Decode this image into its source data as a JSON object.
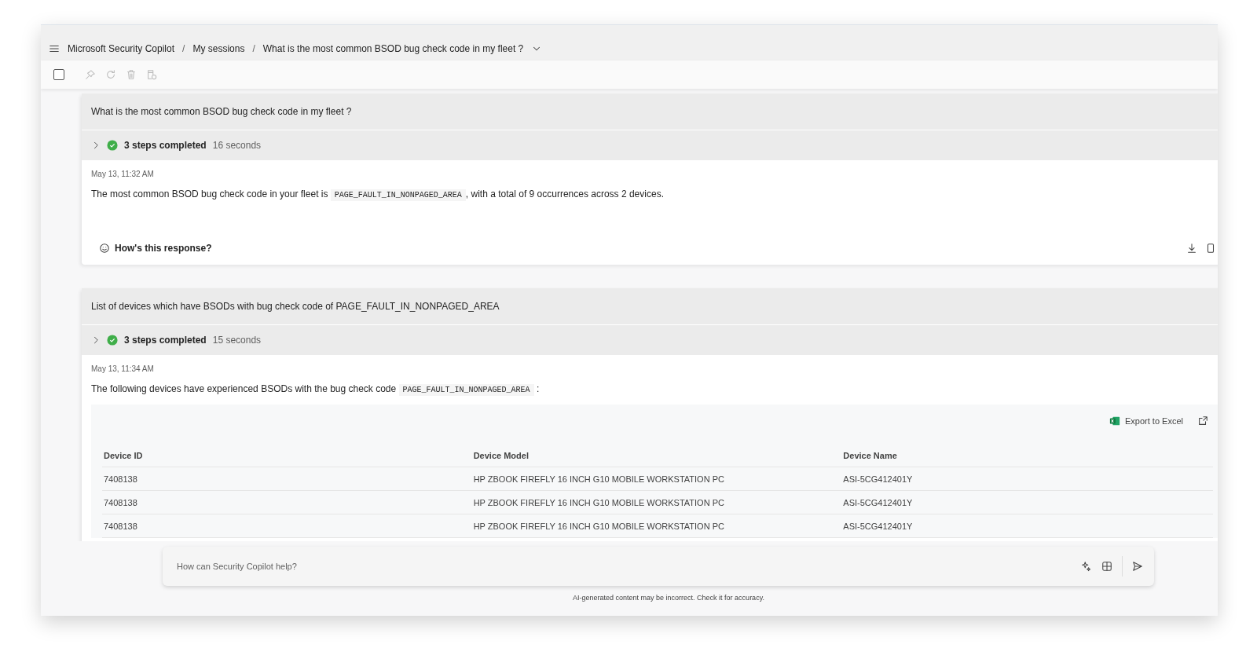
{
  "breadcrumb_separator": "/",
  "breadcrumb": [
    "Microsoft Security Copilot",
    "My sessions",
    "What is the most common BSOD bug check code in my fleet ?"
  ],
  "toolbar": {
    "select_all_checked": false
  },
  "sessions": [
    {
      "prompt": "What is the most common BSOD bug check code in my fleet ?",
      "steps": {
        "expanded": false,
        "label": "3 steps completed",
        "duration": "16 seconds"
      },
      "timestamp": "May 13, 11:32 AM",
      "response": [
        "The most common BSOD bug check code in your fleet is ",
        "PAGE_FAULT_IN_NONPAGED_AREA",
        ", with a total of 9 occurrences across 2 devices."
      ],
      "feedback": "How's this response?"
    },
    {
      "prompt": "List of devices which have BSODs with bug check code of PAGE_FAULT_IN_NONPAGED_AREA",
      "steps": {
        "expanded": false,
        "label": "3 steps completed",
        "duration": "15 seconds"
      },
      "timestamp": "May 13, 11:34 AM",
      "response": [
        "The following devices have experienced BSODs with the bug check code ",
        "PAGE_FAULT_IN_NONPAGED_AREA",
        " :"
      ],
      "table": {
        "export": "Export to Excel",
        "columns": [
          "Device ID",
          "Device Model",
          "Device Name"
        ],
        "rows": [
          [
            "7408138",
            "HP ZBOOK FIREFLY 16 INCH G10 MOBILE WORKSTATION PC",
            "ASI-5CG412401Y"
          ],
          [
            "7408138",
            "HP ZBOOK FIREFLY 16 INCH G10 MOBILE WORKSTATION PC",
            "ASI-5CG412401Y"
          ],
          [
            "7408138",
            "HP ZBOOK FIREFLY 16 INCH G10 MOBILE WORKSTATION PC",
            "ASI-5CG412401Y"
          ]
        ]
      }
    }
  ],
  "prompt_box": {
    "placeholder": "How can Security Copilot help?"
  },
  "disclaimer": "AI-generated content may be incorrect. Check it for accuracy."
}
